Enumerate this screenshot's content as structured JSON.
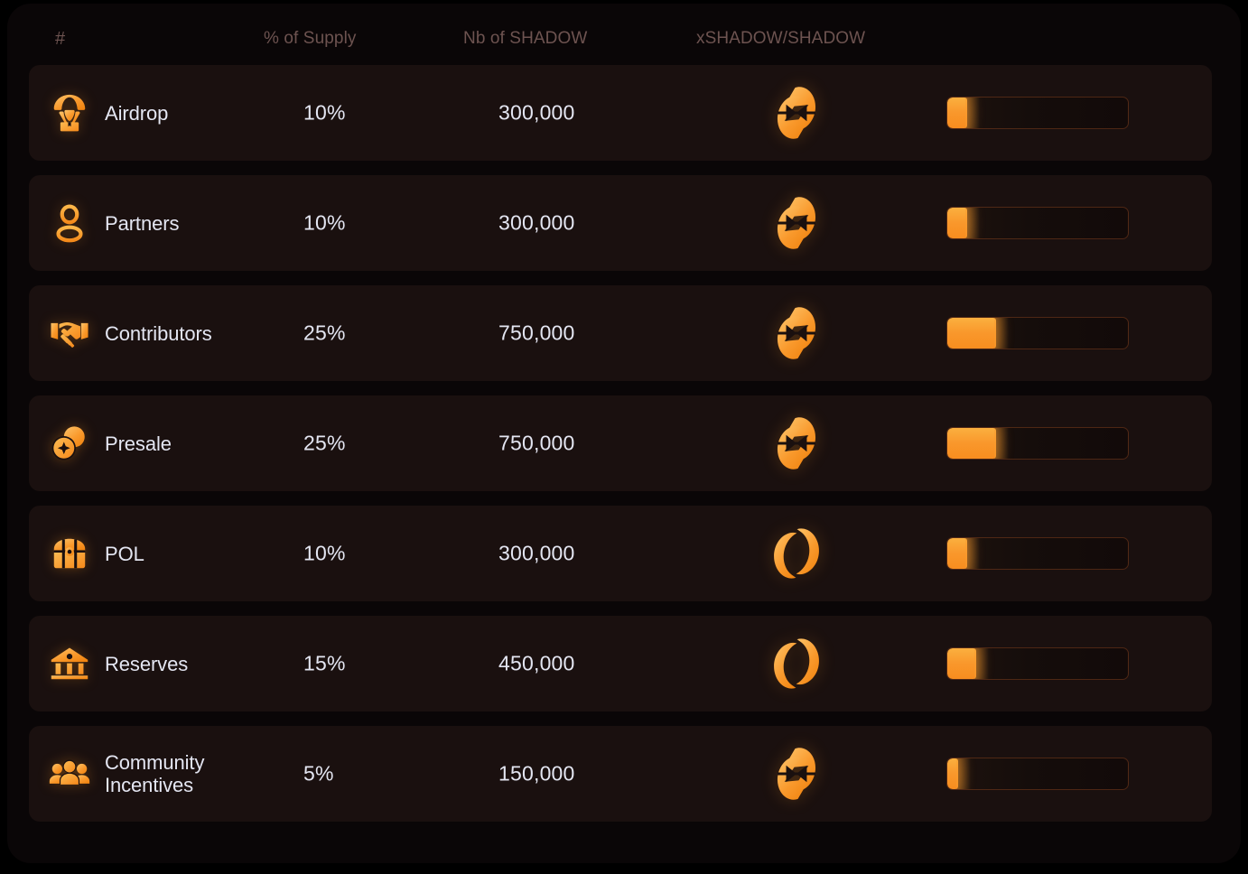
{
  "header": {
    "columns": [
      {
        "key": "hash",
        "label": "#"
      },
      {
        "key": "supply",
        "label": "% of Supply"
      },
      {
        "key": "nb",
        "label": "Nb of SHADOW"
      },
      {
        "key": "ratio",
        "label": "xSHADOW/SHADOW"
      }
    ]
  },
  "colors": {
    "accent": "#f9982c",
    "accent_light": "#fbb03f",
    "row_bg": "#1a100f",
    "page_bg": "#0a0607",
    "outer_bg": "#000000",
    "header_text": "#6d5350",
    "value_text": "#e4e6f2"
  },
  "chart_data": {
    "type": "bar",
    "title": "",
    "xlabel": "",
    "ylabel": "% of Supply",
    "categories": [
      "Airdrop",
      "Partners",
      "Contributors",
      "Presale",
      "POL",
      "Reserves",
      "Community Incentives"
    ],
    "values": [
      10,
      10,
      25,
      25,
      10,
      15,
      5
    ],
    "value_labels": [
      "10%",
      "10%",
      "25%",
      "25%",
      "10%",
      "15%",
      "5%"
    ],
    "token_counts": [
      300000,
      300000,
      750000,
      750000,
      300000,
      450000,
      150000
    ],
    "token_count_labels": [
      "300,000",
      "300,000",
      "750,000",
      "750,000",
      "300,000",
      "450,000",
      "150,000"
    ],
    "ylim": [
      0,
      100
    ],
    "bar_scale_max": 92,
    "grid": false,
    "legend": false
  },
  "rows": [
    {
      "name": "Airdrop",
      "icon": "parachute-package-icon",
      "percent": "10%",
      "percent_value": 10,
      "amount": "300,000",
      "token": "xshadow-logo",
      "bar_pct": 11
    },
    {
      "name": "Partners",
      "icon": "user-icon",
      "percent": "10%",
      "percent_value": 10,
      "amount": "300,000",
      "token": "xshadow-logo",
      "bar_pct": 11
    },
    {
      "name": "Contributors",
      "icon": "handshake-icon",
      "percent": "25%",
      "percent_value": 25,
      "amount": "750,000",
      "token": "xshadow-logo",
      "bar_pct": 27
    },
    {
      "name": "Presale",
      "icon": "coins-sparkle-icon",
      "percent": "25%",
      "percent_value": 25,
      "amount": "750,000",
      "token": "xshadow-logo",
      "bar_pct": 27
    },
    {
      "name": "POL",
      "icon": "treasure-chest-icon",
      "percent": "10%",
      "percent_value": 10,
      "amount": "300,000",
      "token": "shadow-logo",
      "bar_pct": 11
    },
    {
      "name": "Reserves",
      "icon": "bank-icon",
      "percent": "15%",
      "percent_value": 15,
      "amount": "450,000",
      "token": "shadow-logo",
      "bar_pct": 16
    },
    {
      "name": "Community\nIncentives",
      "icon": "people-group-icon",
      "percent": "5%",
      "percent_value": 5,
      "amount": "150,000",
      "token": "xshadow-logo",
      "bar_pct": 6
    }
  ]
}
